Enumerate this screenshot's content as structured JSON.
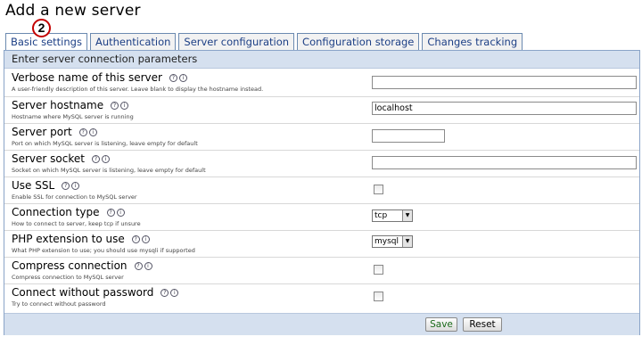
{
  "page": {
    "title": "Add a new server",
    "step_number": "2"
  },
  "tabs": [
    {
      "label": "Basic settings",
      "active": true
    },
    {
      "label": "Authentication",
      "active": false
    },
    {
      "label": "Server configuration",
      "active": false
    },
    {
      "label": "Configuration storage",
      "active": false
    },
    {
      "label": "Changes tracking",
      "active": false
    }
  ],
  "panel": {
    "legend": "Enter server connection parameters"
  },
  "fields": [
    {
      "label": "Verbose name of this server",
      "description": "A user-friendly description of this server. Leave blank to display the hostname instead.",
      "type": "text",
      "value": ""
    },
    {
      "label": "Server hostname",
      "description": "Hostname where MySQL server is running",
      "type": "text",
      "value": "localhost"
    },
    {
      "label": "Server port",
      "description": "Port on which MySQL server is listening, leave empty for default",
      "type": "text",
      "value": ""
    },
    {
      "label": "Server socket",
      "description": "Socket on which MySQL server is listening, leave empty for default",
      "type": "text",
      "value": ""
    },
    {
      "label": "Use SSL",
      "description": "Enable SSL for connection to MySQL server",
      "type": "checkbox",
      "checked": false
    },
    {
      "label": "Connection type",
      "description": "How to connect to server, keep tcp if unsure",
      "type": "select",
      "value": "tcp"
    },
    {
      "label": "PHP extension to use",
      "description": "What PHP extension to use; you should use mysqli if supported",
      "type": "select",
      "value": "mysql"
    },
    {
      "label": "Compress connection",
      "description": "Compress connection to MySQL server",
      "type": "checkbox",
      "checked": false
    },
    {
      "label": "Connect without password",
      "description": "Try to connect without password",
      "type": "checkbox",
      "checked": false
    }
  ],
  "icons": {
    "help": "help-icon",
    "doc": "documentation-icon"
  },
  "buttons": {
    "save_label": "Save",
    "reset_label": "Reset"
  }
}
